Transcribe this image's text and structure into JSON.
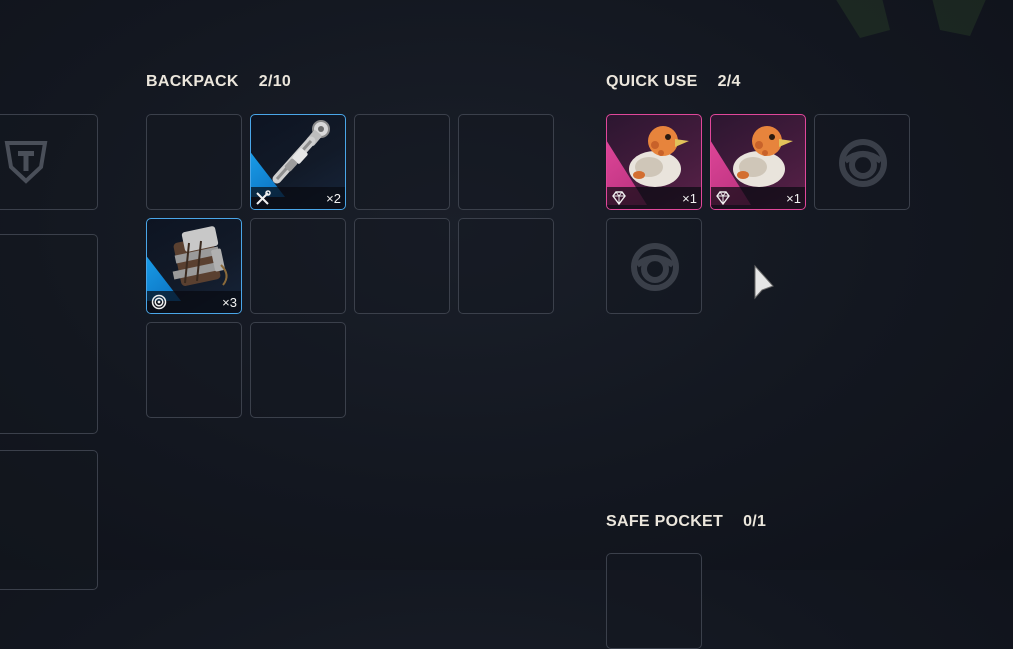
{
  "backpack": {
    "title": "BACKPACK",
    "count": "2/10",
    "slots": [
      {
        "state": "empty"
      },
      {
        "state": "item",
        "item_icon": "grappling-tool-icon",
        "type_icon": "crossed-tools-icon",
        "qty": "×2",
        "rarity_color": "#1ba3ee"
      },
      {
        "state": "empty"
      },
      {
        "state": "empty"
      },
      {
        "state": "item",
        "item_icon": "canister-bundle-icon",
        "type_icon": "target-icon",
        "qty": "×3",
        "rarity_color": "#1ba3ee"
      },
      {
        "state": "empty"
      },
      {
        "state": "empty"
      },
      {
        "state": "empty"
      },
      {
        "state": "empty"
      },
      {
        "state": "empty"
      }
    ]
  },
  "quick_use": {
    "title": "QUICK USE",
    "count": "2/4",
    "slots": [
      {
        "state": "item",
        "item_icon": "rubber-duck-icon",
        "type_icon": "gem-icon",
        "qty": "×1",
        "rarity_color": "#e0479a"
      },
      {
        "state": "item",
        "item_icon": "rubber-duck-icon",
        "type_icon": "gem-icon",
        "qty": "×1",
        "rarity_color": "#e0479a"
      },
      {
        "state": "locked-placeholder",
        "item_icon": "empty-slot-ring-icon"
      },
      {
        "state": "locked-placeholder",
        "item_icon": "empty-slot-ring-icon"
      }
    ]
  },
  "safe_pocket": {
    "title": "SAFE POCKET",
    "count": "0/1"
  },
  "equipment": {
    "shield_slot_icon": "shield-emblem-icon"
  },
  "colors": {
    "rare_blue": "#1ba3ee",
    "epic_pink": "#e0479a",
    "slot_border": "#3b404b",
    "background": "#131720"
  }
}
